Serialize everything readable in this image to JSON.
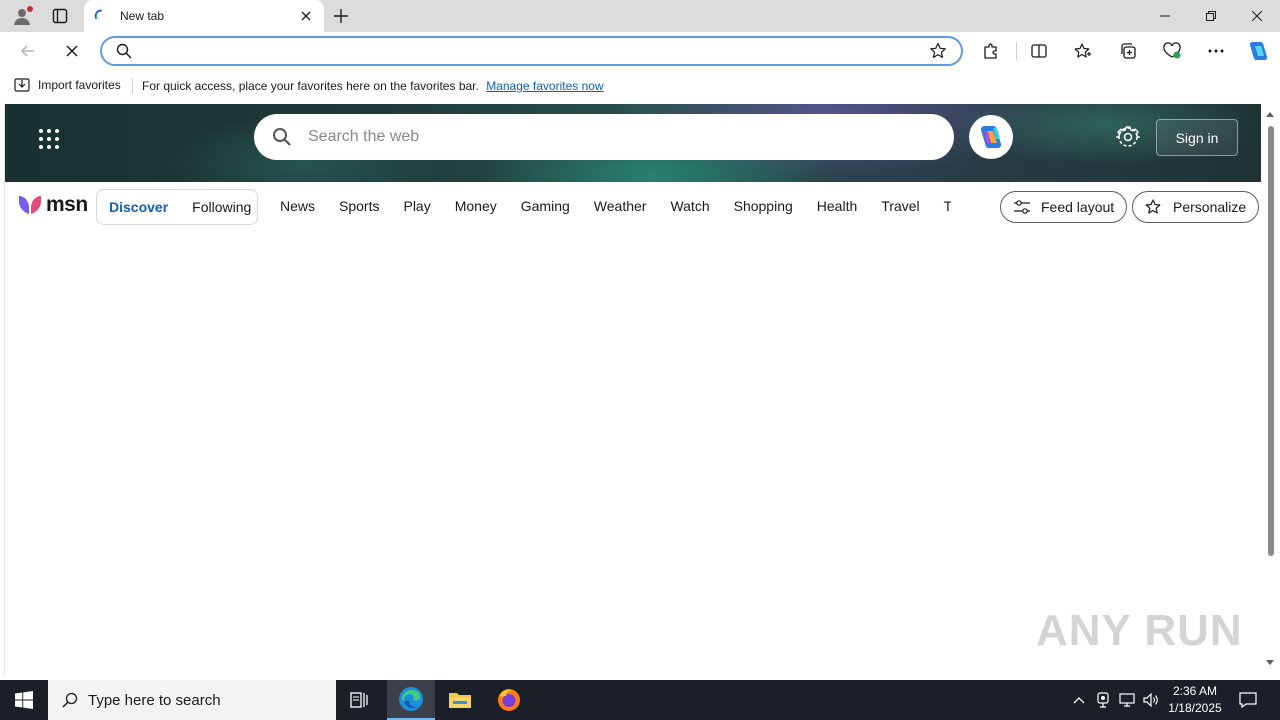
{
  "browser": {
    "tab_title": "New tab",
    "address_value": "",
    "favorites_bar": {
      "import_label": "Import favorites",
      "message": "For quick access, place your favorites here on the favorites bar.",
      "link_label": "Manage favorites now"
    }
  },
  "msn": {
    "search_placeholder": "Search the web",
    "sign_in_label": "Sign in",
    "logo_text": "msn",
    "feed_tabs": [
      "Discover",
      "Following"
    ],
    "categories": [
      "News",
      "Sports",
      "Play",
      "Money",
      "Gaming",
      "Weather",
      "Watch",
      "Shopping",
      "Health",
      "Travel",
      "Trav"
    ],
    "feed_layout_label": "Feed layout",
    "personalize_label": "Personalize"
  },
  "watermark": "ANY RUN",
  "taskbar": {
    "search_placeholder": "Type here to search",
    "time": "2:36 AM",
    "date": "1/18/2025"
  },
  "colors": {
    "accent": "#0f5fbd",
    "address_border": "#5c9ce6",
    "taskbar": "#1b1f27"
  }
}
